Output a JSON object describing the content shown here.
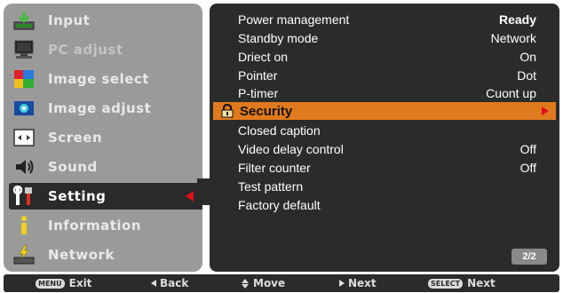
{
  "left_menu": {
    "items": [
      {
        "label": "Input",
        "icon": "input-icon"
      },
      {
        "label": "PC adjust",
        "icon": "pc-adjust-icon"
      },
      {
        "label": "Image select",
        "icon": "image-select-icon"
      },
      {
        "label": "Image adjust",
        "icon": "image-adjust-icon"
      },
      {
        "label": "Screen",
        "icon": "screen-icon"
      },
      {
        "label": "Sound",
        "icon": "sound-icon"
      },
      {
        "label": "Setting",
        "icon": "setting-icon"
      },
      {
        "label": "Information",
        "icon": "information-icon"
      },
      {
        "label": "Network",
        "icon": "network-icon"
      }
    ],
    "active": "Setting"
  },
  "settings_list": {
    "rows": [
      {
        "name": "Power management",
        "value": "Ready"
      },
      {
        "name": "Standby mode",
        "value": "Network"
      },
      {
        "name": "Driect on",
        "value": "On"
      },
      {
        "name": "Pointer",
        "value": "Dot"
      },
      {
        "name": "P-timer",
        "value": "Cuont up"
      },
      {
        "name": "Security",
        "value": ""
      },
      {
        "name": "Closed caption",
        "value": ""
      },
      {
        "name": "Video delay control",
        "value": "Off"
      },
      {
        "name": "Filter counter",
        "value": "Off"
      },
      {
        "name": "Test pattern",
        "value": ""
      },
      {
        "name": "Factory default",
        "value": ""
      }
    ],
    "selected": "Security",
    "page": "2/2"
  },
  "bottom_bar": {
    "exit_key": "MENU",
    "exit_label": "Exit",
    "back_label": "Back",
    "move_label": "Move",
    "next_label": "Next",
    "select_key": "SELECT",
    "select_label": "Next"
  },
  "colors": {
    "highlight": "#e07a1e",
    "arrow": "#e0101a",
    "panel_dark": "#2b2b2b",
    "panel_gray": "#9a9a9a"
  }
}
